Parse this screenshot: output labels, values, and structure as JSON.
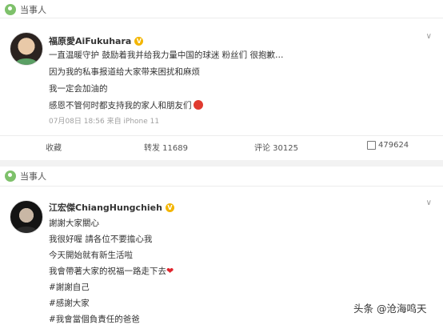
{
  "post1": {
    "tag": "当事人",
    "author": "福原愛AiFukuhara",
    "vip_mark": "V",
    "more": "∨",
    "lines": [
      "一直温暖守护 鼓励着我并给我力量中国的球迷 粉丝们 很抱歉…",
      "因为我的私事报道给大家带来困扰和麻烦",
      "我一定会加油的",
      "感恩不管何时都支持我的家人和朋友们"
    ],
    "meta": "07月08日 18:56 来自 iPhone 11",
    "actions": {
      "collect": "收藏",
      "repost": "转发 11689",
      "comment": "评论 30125",
      "like": "479624"
    }
  },
  "post2": {
    "tag": "当事人",
    "author": "江宏傑ChiangHungchieh",
    "vip_mark": "V",
    "more": "∨",
    "lines": [
      "謝謝大家關心",
      "我很好喔 請各位不要擔心我",
      "今天開始就有新生活啦",
      "我會帶著大家的祝福一路走下去"
    ],
    "hashtags": [
      "#謝謝自己",
      "#感謝大家",
      "#我會當個負責任的爸爸"
    ]
  },
  "watermark": "头条 @沧海鸣天"
}
